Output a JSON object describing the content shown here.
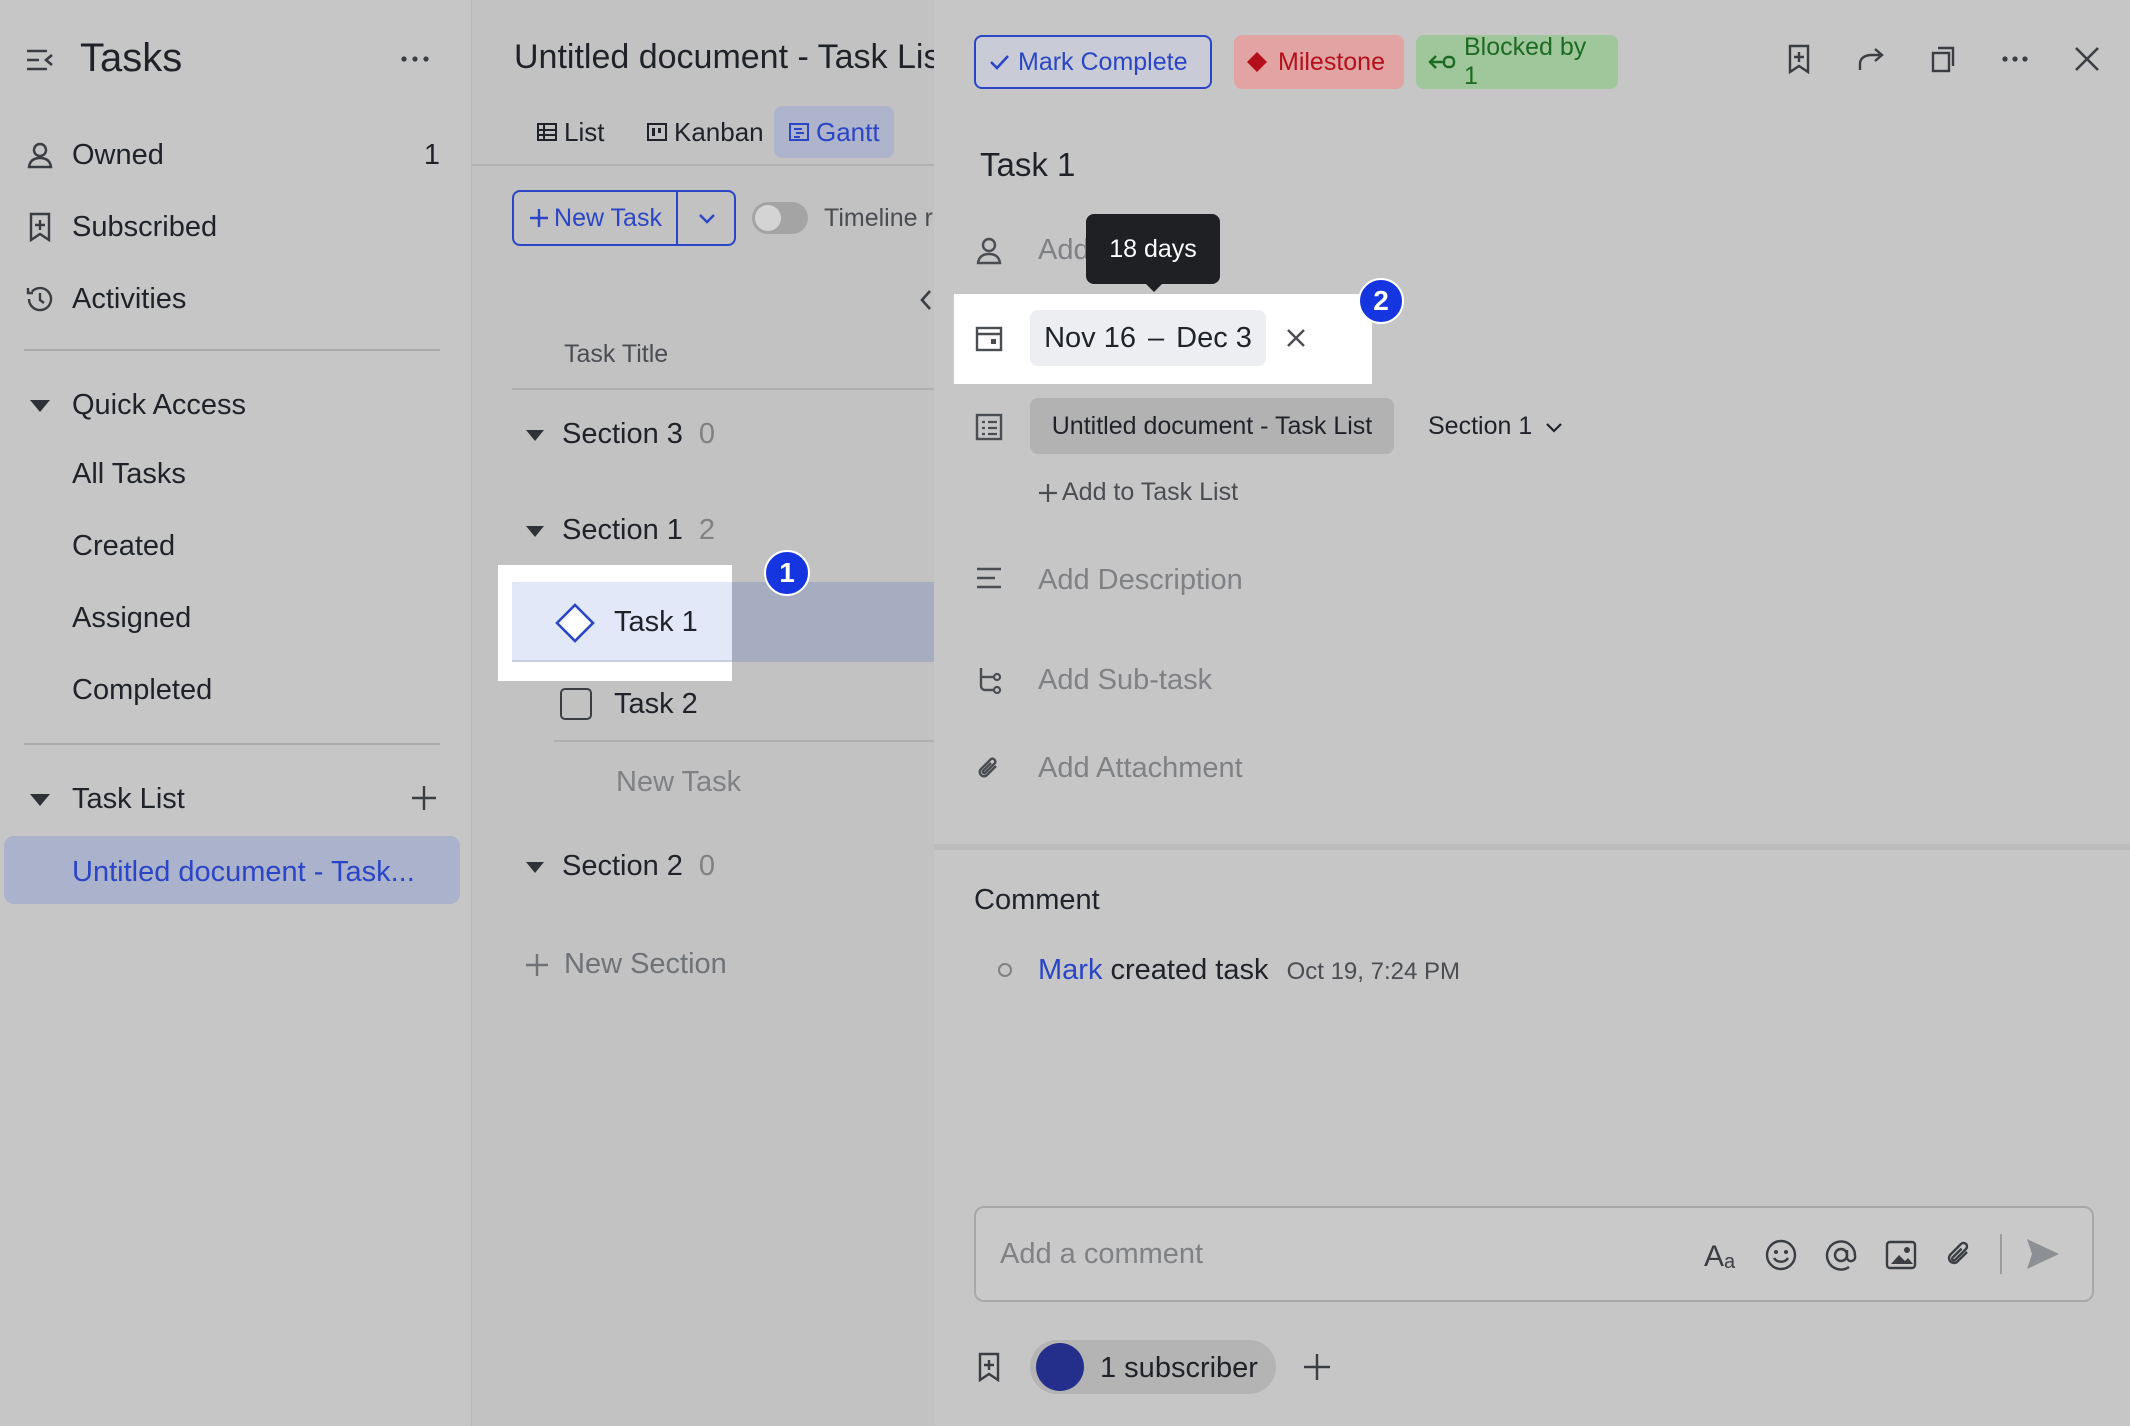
{
  "sidebar": {
    "title": "Tasks",
    "items": [
      {
        "label": "Owned",
        "count": "1"
      },
      {
        "label": "Subscribed"
      },
      {
        "label": "Activities"
      }
    ],
    "quick_access": {
      "label": "Quick Access",
      "items": [
        "All Tasks",
        "Created",
        "Assigned",
        "Completed"
      ]
    },
    "task_list": {
      "label": "Task List",
      "items": [
        "Untitled document - Task..."
      ]
    }
  },
  "middle": {
    "title": "Untitled document - Task Lis",
    "tabs": [
      {
        "label": "List",
        "icon": "list-icon",
        "active": false
      },
      {
        "label": "Kanban",
        "icon": "kanban-icon",
        "active": false
      },
      {
        "label": "Gantt",
        "icon": "gantt-icon",
        "active": true
      }
    ],
    "new_task_label": "New Task",
    "timeline_label": "Timeline r",
    "column_header": "Task Title",
    "sections": [
      {
        "name": "Section 3",
        "count": "0"
      },
      {
        "name": "Section 1",
        "count": "2",
        "tasks": [
          "Task 1",
          "Task 2"
        ],
        "new_task": "New Task"
      },
      {
        "name": "Section 2",
        "count": "0"
      }
    ],
    "new_section_label": "New Section"
  },
  "detail": {
    "mark_complete_label": "Mark Complete",
    "milestone_label": "Milestone",
    "blocked_label": "Blocked by 1",
    "task_title": "Task 1",
    "assignee_placeholder": "Add",
    "tooltip": "18 days",
    "date_start": "Nov 16",
    "date_sep": "–",
    "date_end": "Dec 3",
    "task_list_name": "Untitled document - Task List",
    "section_name": "Section 1",
    "add_to_list": "Add to Task List",
    "add_description": "Add Description",
    "add_subtask": "Add Sub-task",
    "add_attachment": "Add Attachment",
    "comment_heading": "Comment",
    "activity": {
      "user": "Mark",
      "action": "created task",
      "time": "Oct 19, 7:24 PM"
    },
    "comment_placeholder": "Add a comment",
    "subscriber_label": "1 subscriber"
  },
  "annotations": {
    "badge1": "1",
    "badge2": "2"
  },
  "colors": {
    "accent": "#2a46c6",
    "milestone_bg": "#e2a3a3",
    "milestone_text": "#b3101b",
    "blocked_bg": "#9fc79b",
    "blocked_text": "#1d6b22",
    "badge": "#1535e0"
  }
}
